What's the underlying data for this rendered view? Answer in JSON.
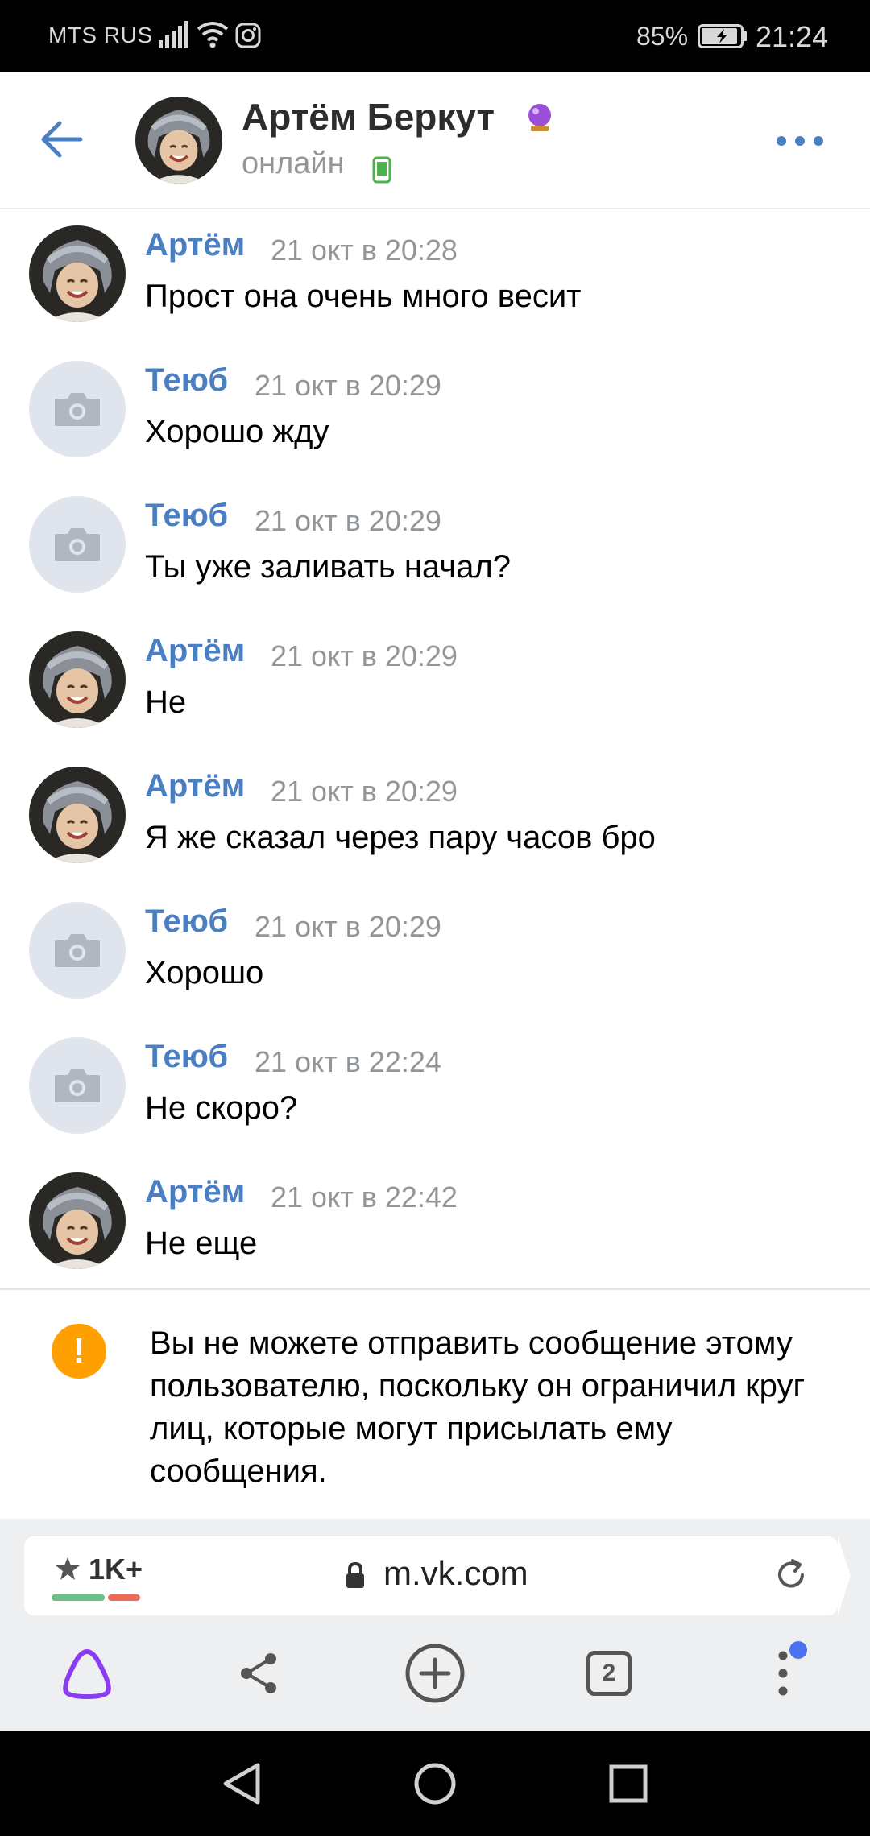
{
  "status_bar": {
    "carrier": "MTS RUS",
    "battery_percent": "85%",
    "time": "21:24"
  },
  "header": {
    "name": "Артём Беркут",
    "status": "онлайн"
  },
  "messages": [
    {
      "author": "Артём",
      "time": "21 окт в 20:28",
      "text": "Прост она очень много весит",
      "avatar": "photo"
    },
    {
      "author": "Теюб",
      "time": "21 окт в 20:29",
      "text": "Хорошо жду",
      "avatar": "camera"
    },
    {
      "author": "Теюб",
      "time": "21 окт в 20:29",
      "text": "Ты уже заливать начал?",
      "avatar": "camera"
    },
    {
      "author": "Артём",
      "time": "21 окт в 20:29",
      "text": "Не",
      "avatar": "photo"
    },
    {
      "author": "Артём",
      "time": "21 окт в 20:29",
      "text": "Я же сказал через пару часов бро",
      "avatar": "photo"
    },
    {
      "author": "Теюб",
      "time": "21 окт в 20:29",
      "text": "Хорошо",
      "avatar": "camera"
    },
    {
      "author": "Теюб",
      "time": "21 окт в 22:24",
      "text": "Не скоро?",
      "avatar": "camera"
    },
    {
      "author": "Артём",
      "time": "21 окт в 22:42",
      "text": "Не еще",
      "avatar": "photo"
    }
  ],
  "notice": {
    "text": "Вы не можете отправить сообщение этому пользователю, поскольку он ограничил круг лиц, которые могут присылать ему сообщения."
  },
  "browser": {
    "rating": "1K+",
    "url": "m.vk.com",
    "tabs_count": "2"
  },
  "colors": {
    "accent": "#4a7fc1",
    "warning": "#ffa000",
    "alice": "#8c3cf0",
    "notification_dot": "#4b72f0"
  }
}
